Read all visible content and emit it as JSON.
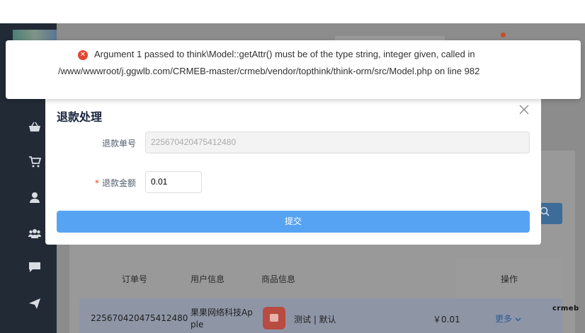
{
  "toast": {
    "icon": "error-icon",
    "color": "#e0472d",
    "line1": "Argument 1 passed to think\\Model::getAttr() must be of the type string, integer given, called in",
    "line2": "/www/wwwroot/j.ggwlb.com/CRMEB-master/crmeb/vendor/topthink/think-orm/src/Model.php on line 982"
  },
  "modal": {
    "title": "退款处理",
    "close_icon": "close-icon",
    "order_label": "退款单号",
    "order_value": "225670420475412480",
    "amount_label": "退款金额",
    "amount_required": "*",
    "amount_value": "0.01",
    "submit_label": "提交",
    "accent": "#57a3f3"
  },
  "sidebar": {
    "icons": [
      "basket-icon",
      "cart-icon",
      "user-icon",
      "users-icon",
      "chat-icon",
      "send-icon"
    ]
  },
  "table": {
    "headers": {
      "order_no": "订单号",
      "user_info": "用户信息",
      "product_info": "商品信息",
      "actions": "操作"
    },
    "row": {
      "order_no": "225670420475412480",
      "user_line1": "果果网络科技Ap",
      "user_line2": "ple",
      "product_spec": "测试 | 默认",
      "price": "￥0.01",
      "more": "更多"
    }
  },
  "brand": "crmeb"
}
